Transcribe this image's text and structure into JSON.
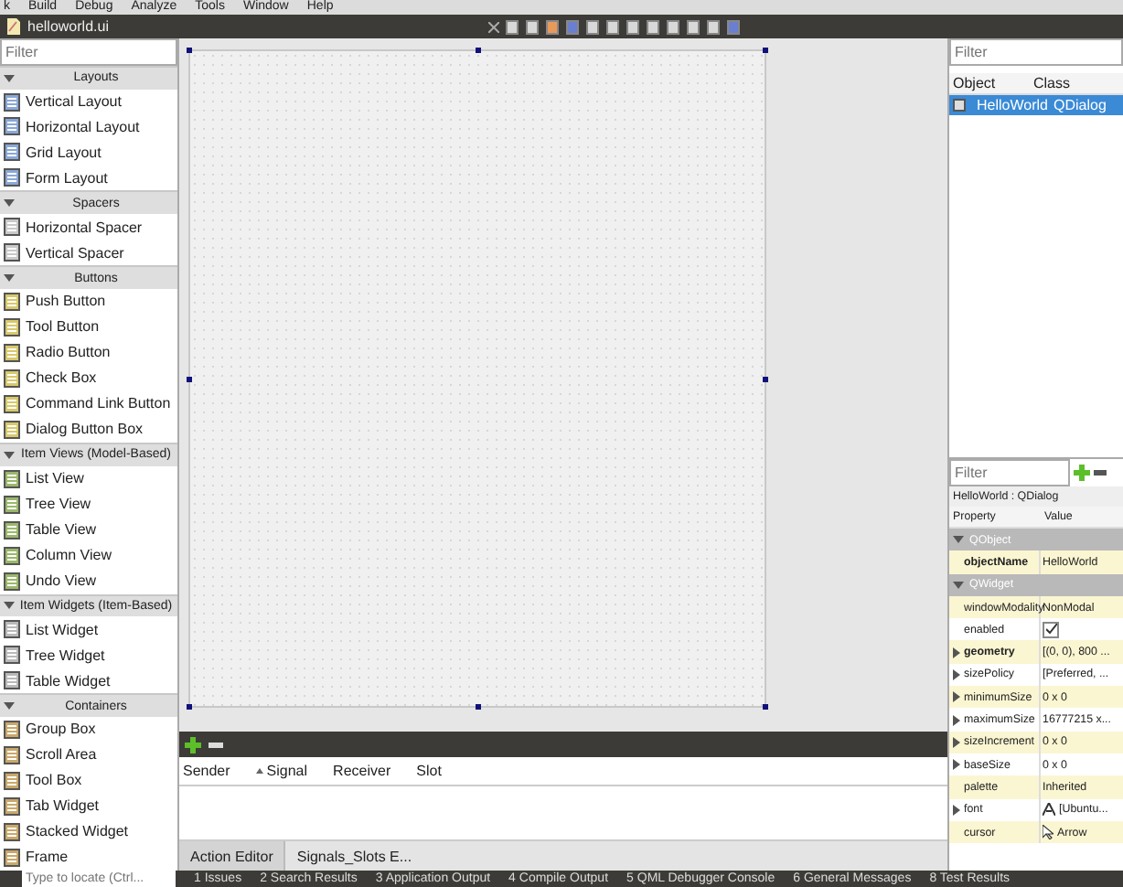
{
  "menu": [
    "k",
    "Build",
    "Debug",
    "Analyze",
    "Tools",
    "Window",
    "Help"
  ],
  "editor_tab": {
    "title": "helloworld.ui"
  },
  "widget_box": {
    "filter": {
      "placeholder": "Filter"
    },
    "categories": [
      {
        "name": "Layouts",
        "expanded": true,
        "items": [
          "Vertical Layout",
          "Horizontal Layout",
          "Grid Layout",
          "Form Layout"
        ]
      },
      {
        "name": "Spacers",
        "expanded": true,
        "items": [
          "Horizontal Spacer",
          "Vertical Spacer"
        ]
      },
      {
        "name": "Buttons",
        "expanded": true,
        "items": [
          "Push Button",
          "Tool Button",
          "Radio Button",
          "Check Box",
          "Command Link Button",
          "Dialog Button Box"
        ]
      },
      {
        "name": "Item Views (Model-Based)",
        "expanded": true,
        "items": [
          "List View",
          "Tree View",
          "Table View",
          "Column View",
          "Undo View"
        ]
      },
      {
        "name": "Item Widgets (Item-Based)",
        "expanded": true,
        "items": [
          "List Widget",
          "Tree Widget",
          "Table Widget"
        ]
      },
      {
        "name": "Containers",
        "expanded": true,
        "items": [
          "Group Box",
          "Scroll Area",
          "Tool Box",
          "Tab Widget",
          "Stacked Widget",
          "Frame"
        ]
      }
    ]
  },
  "signal_editor": {
    "columns": [
      "Sender",
      "Signal",
      "Receiver",
      "Slot"
    ],
    "tabs": [
      {
        "label": "Action Editor",
        "selected": true
      },
      {
        "label": "Signals_Slots E...",
        "selected": false
      }
    ]
  },
  "object_inspector": {
    "filter": {
      "placeholder": "Filter"
    },
    "columns": [
      "Object",
      "Class"
    ],
    "rows": [
      {
        "object": "HelloWorld",
        "class": "QDialog",
        "selected": true
      }
    ]
  },
  "property_editor": {
    "filter": {
      "placeholder": "Filter"
    },
    "title": "HelloWorld : QDialog",
    "columns": [
      "Property",
      "Value"
    ],
    "rows": [
      {
        "kind": "group",
        "name": "QObject"
      },
      {
        "kind": "prop",
        "name": "objectName",
        "value": "HelloWorld",
        "modified": true,
        "expandable": false
      },
      {
        "kind": "group",
        "name": "QWidget"
      },
      {
        "kind": "prop",
        "name": "windowModality",
        "value": "NonModal",
        "modified": false,
        "expandable": false
      },
      {
        "kind": "check",
        "name": "enabled",
        "checked": true,
        "modified": false,
        "expandable": false
      },
      {
        "kind": "prop",
        "name": "geometry",
        "value": "[(0, 0), 800 ...",
        "modified": true,
        "expandable": true
      },
      {
        "kind": "prop",
        "name": "sizePolicy",
        "value": "[Preferred, ...",
        "modified": false,
        "expandable": true
      },
      {
        "kind": "prop",
        "name": "minimumSize",
        "value": "0 x 0",
        "modified": false,
        "expandable": true
      },
      {
        "kind": "prop",
        "name": "maximumSize",
        "value": "16777215 x...",
        "modified": false,
        "expandable": true
      },
      {
        "kind": "prop",
        "name": "sizeIncrement",
        "value": "0 x 0",
        "modified": false,
        "expandable": true
      },
      {
        "kind": "prop",
        "name": "baseSize",
        "value": "0 x 0",
        "modified": false,
        "expandable": true
      },
      {
        "kind": "prop",
        "name": "palette",
        "value": "Inherited",
        "modified": false,
        "expandable": false
      },
      {
        "kind": "font",
        "name": "font",
        "value": "[Ubuntu...",
        "modified": false,
        "expandable": true
      },
      {
        "kind": "cursor",
        "name": "cursor",
        "value": "Arrow",
        "modified": false,
        "expandable": false
      }
    ]
  },
  "status_bar": {
    "locator": {
      "placeholder": "Type to locate (Ctrl..."
    },
    "panes": [
      "1 Issues",
      "2 Search Results",
      "3 Application Output",
      "4 Compile Output",
      "5 QML Debugger Console",
      "6 General Messages",
      "8 Test Results"
    ]
  }
}
